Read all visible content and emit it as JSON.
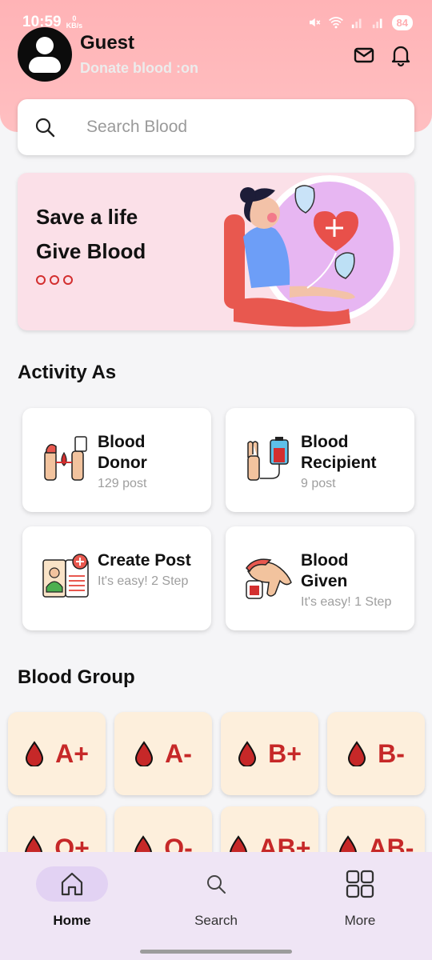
{
  "status": {
    "time": "10:59",
    "kb_value": "0",
    "kb_unit": "KB/s",
    "battery": "84"
  },
  "profile": {
    "name": "Guest",
    "subtitle": "Donate blood :on",
    "avatar_icon": "user-avatar-icon"
  },
  "header_icons": [
    "mail-icon",
    "bell-icon"
  ],
  "search": {
    "placeholder": "Search Blood",
    "icon": "search-icon"
  },
  "banner": {
    "line1": "Save a life",
    "line2": "Give Blood",
    "slides": 3,
    "illustration": "blood-donation-illustration"
  },
  "activity": {
    "title": "Activity As",
    "cards": [
      {
        "title": "Blood\nDonor",
        "subtitle": "129 post",
        "icon": "blood-donor-icon"
      },
      {
        "title": "Blood\nRecipient",
        "subtitle": "9 post",
        "icon": "blood-recipient-icon"
      },
      {
        "title": "Create Post",
        "subtitle": "It's easy! 2 Step",
        "icon": "create-post-icon"
      },
      {
        "title": "Blood\nGiven",
        "subtitle": "It's easy! 1 Step",
        "icon": "blood-given-icon"
      }
    ]
  },
  "blood_group": {
    "title": "Blood Group",
    "groups": [
      "A+",
      "A-",
      "B+",
      "B-",
      "O+",
      "O-",
      "AB+",
      "AB-"
    ]
  },
  "nav": {
    "items": [
      {
        "label": "Home",
        "icon": "home-icon",
        "active": true
      },
      {
        "label": "Search",
        "icon": "search-icon",
        "active": false
      },
      {
        "label": "More",
        "icon": "grid-icon",
        "active": false
      }
    ]
  },
  "colors": {
    "header": "#ffb3b6",
    "banner": "#fbe0e8",
    "blood_red": "#c62828",
    "tile": "#fdefdc",
    "nav": "#efe5f5"
  }
}
